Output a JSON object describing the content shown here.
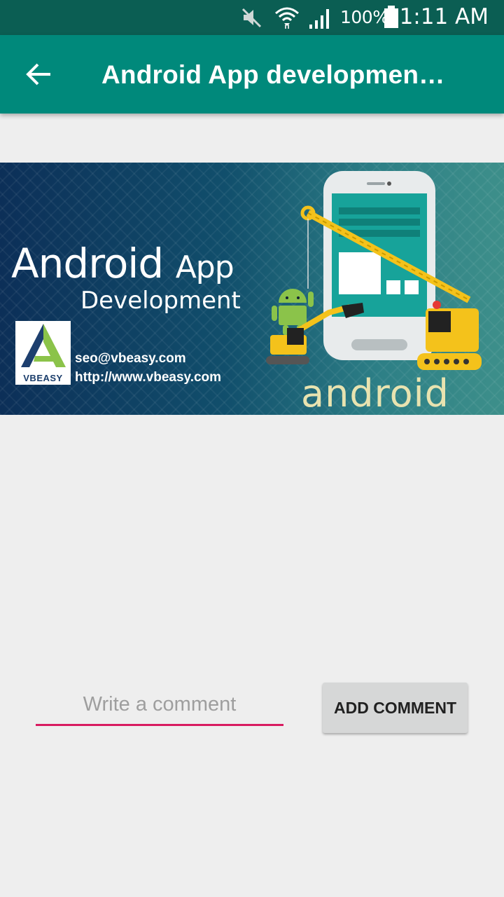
{
  "status_bar": {
    "battery": "100%",
    "time": "1:11 AM",
    "icons": [
      "mute-icon",
      "wifi-icon",
      "signal-icon",
      "battery-icon"
    ]
  },
  "app_bar": {
    "back_icon": "arrow-back-icon",
    "title": "Android App development course",
    "background": "#00897b"
  },
  "banner": {
    "title_line1_main": "Android",
    "title_line1_suffix": "App",
    "title_line2": "Development",
    "logo_text": "VBEASY",
    "email": "seo@vbeasy.com",
    "website": "http://www.vbeasy.com",
    "android_word": "android"
  },
  "comment": {
    "placeholder": "Write a comment",
    "value": "",
    "button_label": "ADD COMMENT",
    "accent": "#d81b60"
  }
}
